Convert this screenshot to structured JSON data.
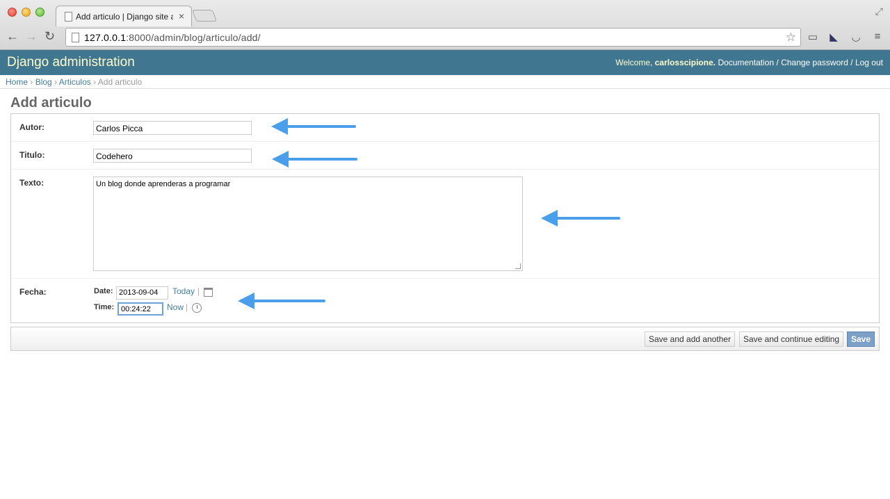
{
  "browser": {
    "tab_title": "Add articulo | Django site admin",
    "tab_close": "×",
    "url_host": "127.0.0.1",
    "url_rest": ":8000/admin/blog/articulo/add/"
  },
  "header": {
    "branding": "Django administration",
    "welcome": "Welcome,",
    "username": "carlosscipione.",
    "links": [
      "Documentation",
      "Change password",
      "Log out"
    ],
    "separator": "/"
  },
  "breadcrumbs": {
    "items": [
      "Home",
      "Blog",
      "Articulos"
    ],
    "current": "Add articulo",
    "separator": "›"
  },
  "page": {
    "title": "Add articulo"
  },
  "form": {
    "autor_label": "Autor:",
    "autor_value": "Carlos Picca",
    "titulo_label": "Titulo:",
    "titulo_value": "Codehero",
    "texto_label": "Texto:",
    "texto_value": "Un blog donde aprenderas a programar",
    "fecha_label": "Fecha:",
    "date_label": "Date:",
    "date_value": "2013-09-04",
    "today_link": "Today",
    "time_label": "Time:",
    "time_value": "00:24:22",
    "now_link": "Now",
    "pipe": "|"
  },
  "actions": {
    "save_add_another": "Save and add another",
    "save_continue": "Save and continue editing",
    "save": "Save"
  },
  "colors": {
    "header_bg": "#417690",
    "branding": "#ffffcc",
    "link": "#447e9b",
    "arrow": "#4a9eea"
  }
}
